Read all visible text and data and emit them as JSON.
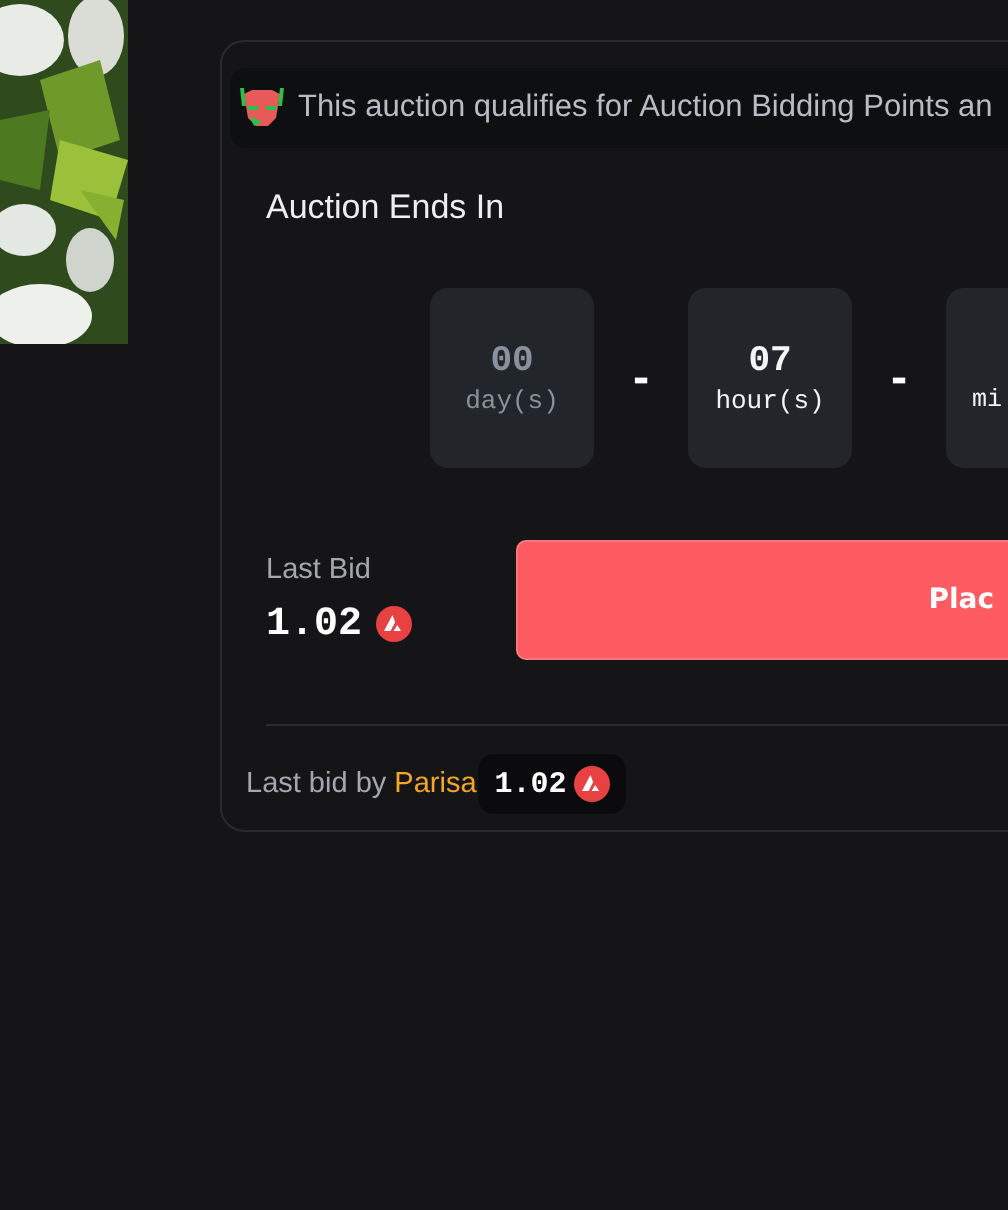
{
  "banner": {
    "text": "This auction qualifies for Auction Bidding Points an"
  },
  "countdown": {
    "title": "Auction Ends In",
    "units": [
      {
        "value": "00",
        "label": "day(s)",
        "active": false
      },
      {
        "value": "07",
        "label": "hour(s)",
        "active": true
      },
      {
        "label": "mi",
        "active": true
      }
    ],
    "separator": "-"
  },
  "last_bid": {
    "label": "Last Bid",
    "amount": "1.02"
  },
  "place_bid_button": "Plac",
  "footer": {
    "prefix": "Last bid by",
    "bidder": "Parisa",
    "amount": "1.02"
  }
}
